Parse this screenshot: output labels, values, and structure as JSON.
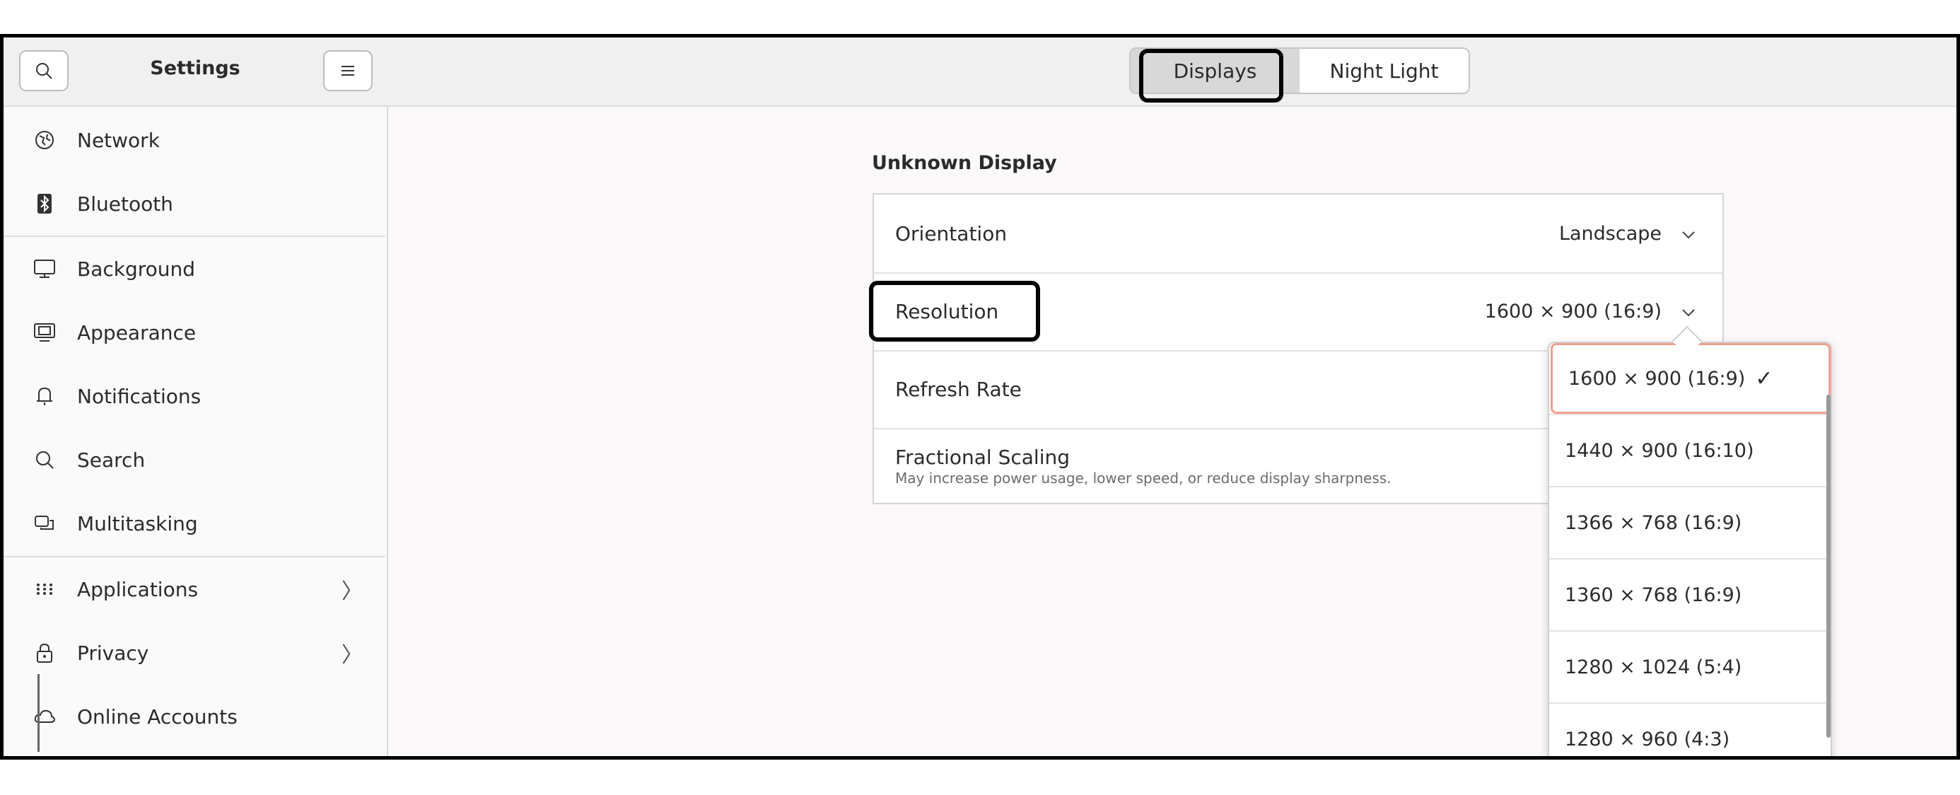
{
  "sidebar": {
    "title": "Settings",
    "items": [
      {
        "label": "Network",
        "icon": "globe-icon"
      },
      {
        "label": "Bluetooth",
        "icon": "bluetooth-icon"
      },
      {
        "label": "Background",
        "icon": "monitor-icon"
      },
      {
        "label": "Appearance",
        "icon": "appearance-icon"
      },
      {
        "label": "Notifications",
        "icon": "bell-icon"
      },
      {
        "label": "Search",
        "icon": "search-icon"
      },
      {
        "label": "Multitasking",
        "icon": "multitasking-icon"
      },
      {
        "label": "Applications",
        "icon": "apps-grid-icon"
      },
      {
        "label": "Privacy",
        "icon": "lock-icon"
      },
      {
        "label": "Online Accounts",
        "icon": "cloud-icon"
      }
    ]
  },
  "header": {
    "tabs": [
      {
        "label": "Displays",
        "active": true
      },
      {
        "label": "Night Light",
        "active": false
      }
    ]
  },
  "display": {
    "title": "Unknown Display",
    "orientation": {
      "label": "Orientation",
      "value": "Landscape"
    },
    "resolution": {
      "label": "Resolution",
      "value": "1600 × 900 (16:9)"
    },
    "refresh_rate": {
      "label": "Refresh Rate"
    },
    "fractional_scaling": {
      "label": "Fractional Scaling",
      "description": "May increase power usage, lower speed, or reduce display sharpness."
    }
  },
  "resolution_menu": {
    "options": [
      "1600 × 900 (16:9)",
      "1440 × 900 (16:10)",
      "1366 × 768 (16:9)",
      "1360 × 768 (16:9)",
      "1280 × 1024 (5:4)",
      "1280 × 960 (4:3)"
    ],
    "selected": "1600 × 900 (16:9)",
    "check_glyph": "✓"
  },
  "colors": {
    "selected_outline": "#f2a08e",
    "active_tab": "#d8d8d8"
  }
}
